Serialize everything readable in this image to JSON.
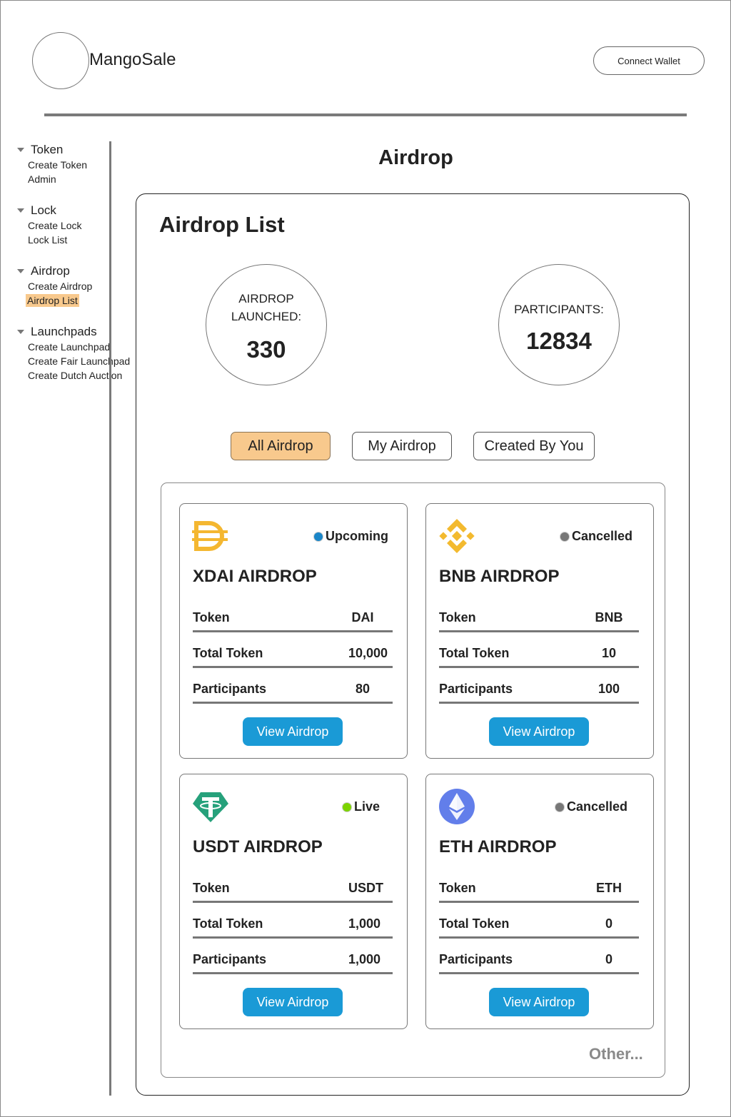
{
  "header": {
    "brand": "MangoSale",
    "connect_label": "Connect Wallet"
  },
  "sidebar": {
    "groups": [
      {
        "title": "Token",
        "items": [
          "Create Token",
          "Admin"
        ]
      },
      {
        "title": "Lock",
        "items": [
          "Create Lock",
          "Lock List"
        ]
      },
      {
        "title": "Airdrop",
        "items": [
          "Create Airdrop",
          "Airdrop List"
        ]
      },
      {
        "title": "Launchpads",
        "items": [
          "Create Launchpad",
          "Create Fair Launchpad",
          "Create Dutch Auction"
        ]
      }
    ],
    "active_item": "Airdrop List"
  },
  "page": {
    "title": "Airdrop",
    "panel_title": "Airdrop List"
  },
  "stats": {
    "launched_label_1": "AIRDROP",
    "launched_label_2": "LAUNCHED:",
    "launched_value": "330",
    "participants_label": "PARTICIPANTS:",
    "participants_value": "12834"
  },
  "tabs": [
    {
      "label": "All Airdrop",
      "active": true
    },
    {
      "label": "My Airdrop",
      "active": false
    },
    {
      "label": "Created By You",
      "active": false
    }
  ],
  "colors": {
    "accent": "#f8c98d",
    "button": "#1a9ad6",
    "status_upcoming": "#1a86c8",
    "status_cancelled": "#777777",
    "status_live": "#7cd300"
  },
  "cards": [
    {
      "icon": "dai-icon",
      "status": "Upcoming",
      "status_color": "#1a86c8",
      "title": "XDAI AIRDROP",
      "rows": [
        {
          "label": "Token",
          "value": "DAI"
        },
        {
          "label": "Total Token",
          "value": "10,000"
        },
        {
          "label": "Participants",
          "value": "80"
        }
      ],
      "button": "View Airdrop"
    },
    {
      "icon": "bnb-icon",
      "status": "Cancelled",
      "status_color": "#777777",
      "title": "BNB AIRDROP",
      "rows": [
        {
          "label": "Token",
          "value": "BNB"
        },
        {
          "label": "Total Token",
          "value": "10"
        },
        {
          "label": "Participants",
          "value": "100"
        }
      ],
      "button": "View Airdrop"
    },
    {
      "icon": "usdt-icon",
      "status": "Live",
      "status_color": "#7cd300",
      "title": "USDT AIRDROP",
      "rows": [
        {
          "label": "Token",
          "value": "USDT"
        },
        {
          "label": "Total Token",
          "value": "1,000"
        },
        {
          "label": "Participants",
          "value": "1,000"
        }
      ],
      "button": "View Airdrop"
    },
    {
      "icon": "eth-icon",
      "status": "Cancelled",
      "status_color": "#777777",
      "title": "ETH AIRDROP",
      "rows": [
        {
          "label": "Token",
          "value": "ETH"
        },
        {
          "label": "Total Token",
          "value": "0"
        },
        {
          "label": "Participants",
          "value": "0"
        }
      ],
      "button": "View Airdrop"
    }
  ],
  "other_label": "Other..."
}
